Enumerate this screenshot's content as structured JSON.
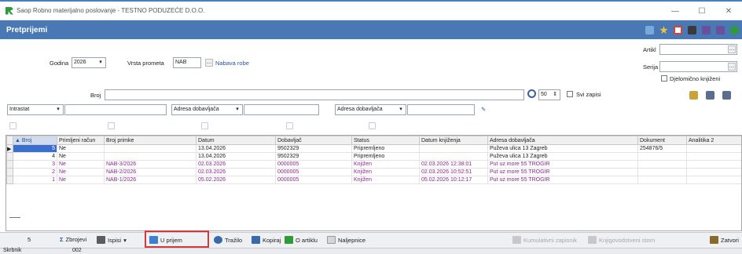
{
  "window": {
    "title": "Saop Robno materijalno poslovanje - TESTNO PODUZEĆE D.O.O.",
    "minimize": "—",
    "maximize": "☐",
    "close": "✕"
  },
  "form": {
    "title": "Pretprijemi"
  },
  "filters": {
    "godina_label": "Godina",
    "godina_value": "2026",
    "vrsta_label": "Vrsta prometa",
    "vrsta_value": "NAB",
    "vrsta_desc": "Nabava robe",
    "artikl_label": "Artikl",
    "artikl_value": "",
    "serija_label": "Serija",
    "serija_value": "",
    "djelomicno_label": "Djelomično knjiženi",
    "broj_label": "Broj",
    "broj_value": "",
    "count_value": "50",
    "svi_zapisi_label": "Svi zapisi",
    "filter1_field": "Intrastat",
    "filter2_field": "Adresa dobavljača",
    "filter3_field": "Adresa dobavljača"
  },
  "grid": {
    "columns": [
      "Broj",
      "Primljeni račun",
      "Broj primke",
      "Datum",
      "Dobavljač",
      "Status",
      "Datum knjiženja",
      "Adresa dobavljača",
      "Dokument",
      "Analitika 2"
    ],
    "rows": [
      {
        "broj": "5",
        "primljeni": "Ne",
        "primka": "",
        "datum": "13.04.2026",
        "dobavljac": "9502329",
        "status": "Pripremljeno",
        "datum_knj": "",
        "adresa": "Puževa ulica 13 Zagreb",
        "dokument": "254876/5",
        "analitika": ""
      },
      {
        "broj": "4",
        "primljeni": "Ne",
        "primka": "",
        "datum": "13.04.2026",
        "dobavljac": "9502329",
        "status": "Pripremljeno",
        "datum_knj": "",
        "adresa": "Puževa ulica 13 Zagreb",
        "dokument": "",
        "analitika": ""
      },
      {
        "broj": "3",
        "primljeni": "Ne",
        "primka": "NAB-3/2026",
        "datum": "02.03.2026",
        "dobavljac": "0000005",
        "status": "Knjižen",
        "datum_knj": "02.03.2026 12:38:01",
        "adresa": "Put uz more 55 TROGIR",
        "dokument": "",
        "analitika": ""
      },
      {
        "broj": "2",
        "primljeni": "Ne",
        "primka": "NAB-2/2026",
        "datum": "02.03.2026",
        "dobavljac": "0000005",
        "status": "Knjižen",
        "datum_knj": "02.03.2026 10:52:51",
        "adresa": "Put uz more 55 TROGIR",
        "dokument": "",
        "analitika": ""
      },
      {
        "broj": "1",
        "primljeni": "Ne",
        "primka": "NAB-1/2026",
        "datum": "05.02.2026",
        "dobavljac": "0000005",
        "status": "Knjižen",
        "datum_knj": "05.02.2026 10:12:17",
        "adresa": "Put uz more 55 TROGIR",
        "dokument": "",
        "analitika": ""
      }
    ]
  },
  "statusbar": {
    "count": "5",
    "zbrojevi": "Zbrojevi",
    "ispisi": "Ispisi",
    "u_prijem": "U prijem",
    "trazilo": "Tražilo",
    "kopiraj": "Kopiraj",
    "o_artiklu": "O artiklu",
    "naljepnice": "Naljepnice",
    "kumulativni": "Kumulativni zapisnik",
    "knjigovodstveni": "Knjigovodstveni storn",
    "zatvori": "Zatvori"
  },
  "bottom": {
    "user": "Skrbnik",
    "code": "002"
  },
  "colors": {
    "header": "#4a78b4",
    "posted_row": "#8b2a8b",
    "highlight": "#d23b3b"
  }
}
